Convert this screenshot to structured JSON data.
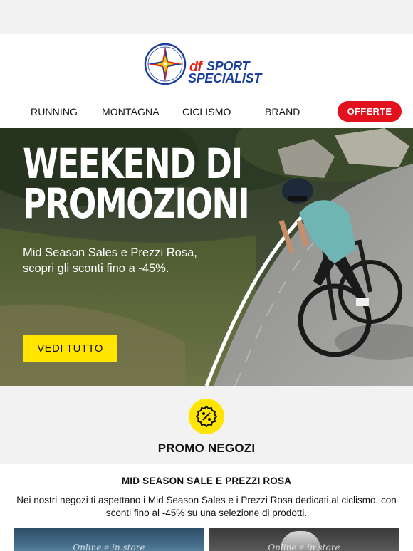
{
  "brand": {
    "logo_df": "df",
    "logo_line1": "SPORT",
    "logo_line2": "SPECIALIST"
  },
  "nav": {
    "items": [
      "RUNNING",
      "MONTAGNA",
      "CICLISMO",
      "BRAND"
    ],
    "offerte": "OFFERTE"
  },
  "hero": {
    "title_line1": "WEEKEND DI",
    "title_line2": "PROMOZIONI",
    "subtitle": "Mid Season Sales e Prezzi Rosa, scopri gli sconti fino a -45%.",
    "cta": "VEDI TUTTO"
  },
  "promo": {
    "icon": "percent-badge-icon",
    "title": "PROMO NEGOZI"
  },
  "content": {
    "title": "MID SEASON SALE E PREZZI ROSA",
    "text": "Nei nostri negozi ti aspettano i Mid Season Sales e i Prezzi Rosa dedicati al ciclismo, con sconti fino al -45% su una selezione di prodotti.",
    "thumbs": [
      {
        "label": "Online e in store"
      },
      {
        "label": "Online e in store"
      }
    ]
  },
  "colors": {
    "accent_red": "#e3101d",
    "accent_yellow": "#ffe500",
    "brand_blue": "#1b3f9c"
  }
}
